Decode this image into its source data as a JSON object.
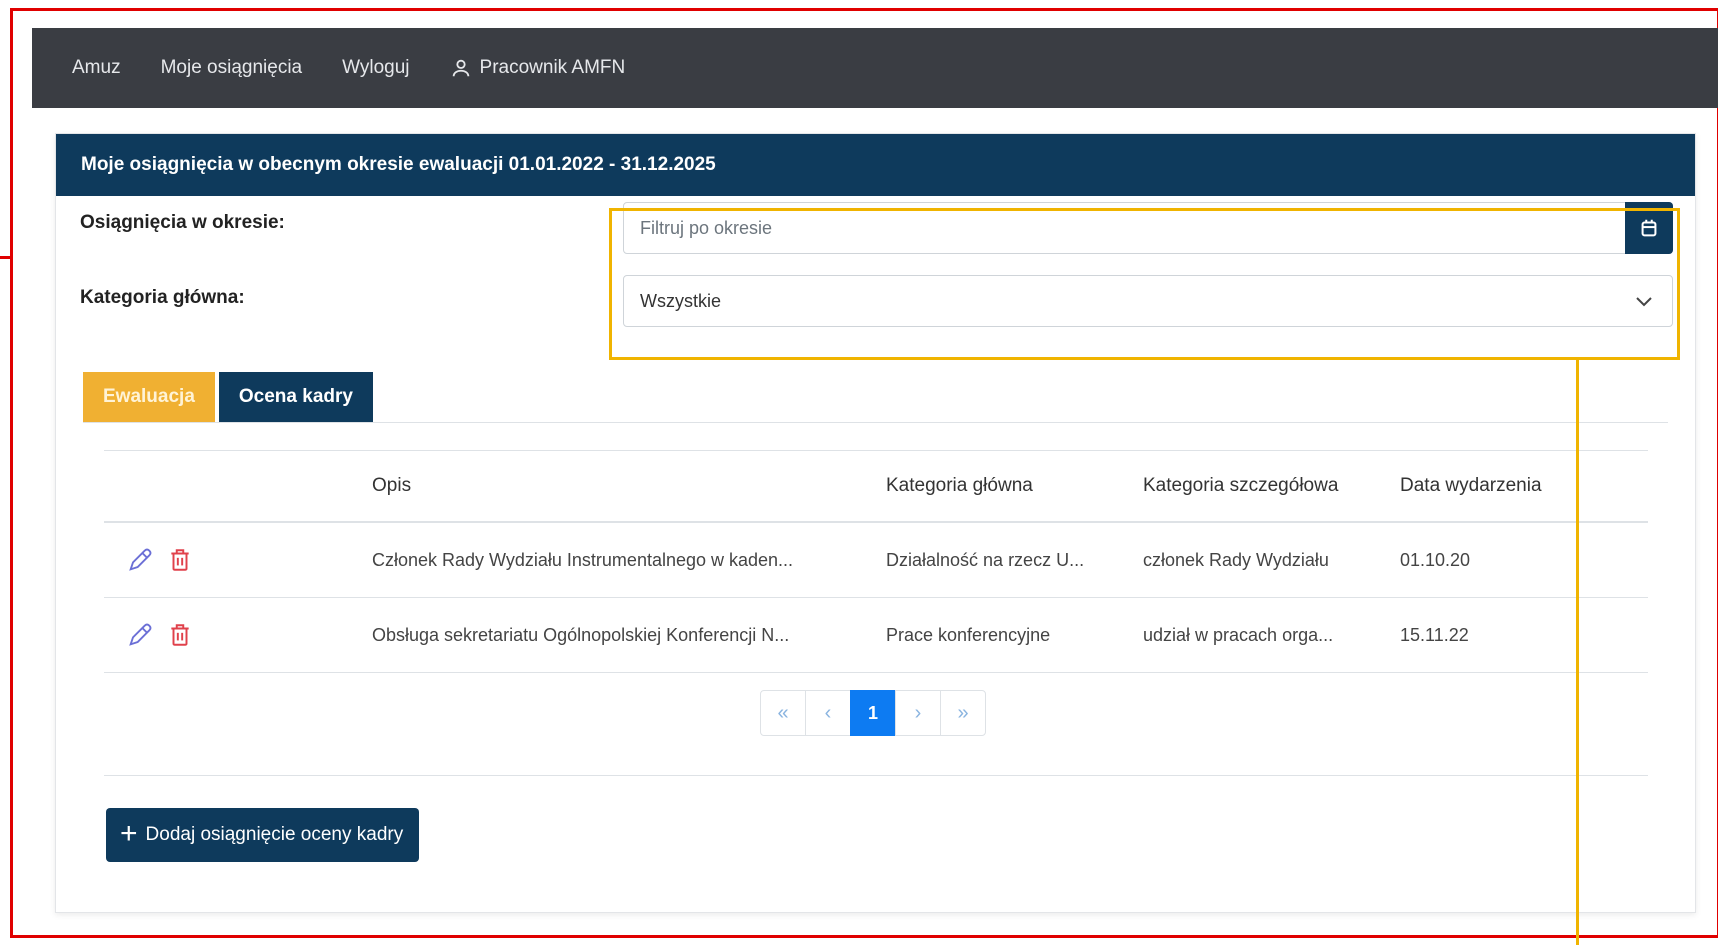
{
  "nav": {
    "items": [
      "Amuz",
      "Moje osiągnięcia",
      "Wyloguj"
    ],
    "user_label": "Pracownik AMFN"
  },
  "card": {
    "title": "Moje osiągnięcia w obecnym okresie ewaluacji 01.01.2022 - 31.12.2025"
  },
  "filters": {
    "period_label": "Osiągnięcia w okresie:",
    "period_placeholder": "Filtruj po okresie",
    "category_label": "Kategoria główna:",
    "category_value": "Wszystkie"
  },
  "tabs": [
    "Ewaluacja",
    "Ocena kadry"
  ],
  "table": {
    "headers": [
      "Opis",
      "Kategoria główna",
      "Kategoria szczegółowa",
      "Data wydarzenia"
    ],
    "rows": [
      {
        "opis": "Członek Rady Wydziału Instrumentalnego w kaden...",
        "kategoria": "Działalność na rzecz U...",
        "szczegolowa": "członek Rady Wydziału",
        "data": "01.10.20"
      },
      {
        "opis": "Obsługa sekretariatu Ogólnopolskiej Konferencji N...",
        "kategoria": "Prace konferencyjne",
        "szczegolowa": "udział w pracach orga...",
        "data": "15.11.22"
      }
    ]
  },
  "pagination": {
    "first": "«",
    "prev": "‹",
    "current": "1",
    "next": "›",
    "last": "»"
  },
  "add_button": {
    "label": "Dodaj osiągnięcie oceny kadry",
    "icon": "+"
  },
  "colors": {
    "navbar": "#3a3d43",
    "primary": "#0e3a5c",
    "accent": "#f0b032",
    "active_page": "#0d7bf2",
    "highlight_frame": "#f0b400",
    "outer_frame": "#e00000"
  }
}
